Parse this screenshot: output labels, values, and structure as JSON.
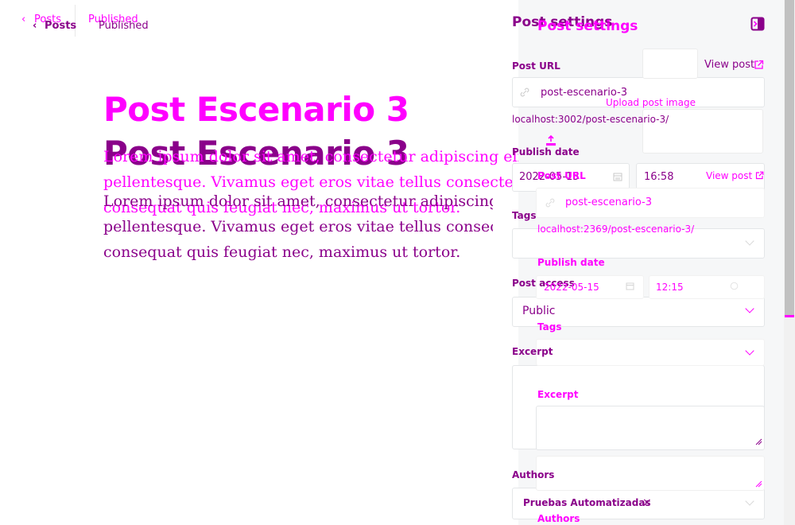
{
  "nav": {
    "back_label": "Posts",
    "status_label": "Published",
    "back_chevron": "‹",
    "back_icon": "chevron-left-icon"
  },
  "editor": {
    "title": "Post Escenario 3",
    "body_lines": [
      "Lorem ipsum dolor sit amet, consectetur adipiscing elit. Ut gravida",
      "pellentesque. Vivamus eget eros vitae tellus consectetur porttitor",
      "consequat quis feugiat nec, maximus ut tortor."
    ]
  },
  "settings_panel": {
    "title": "Post settings",
    "close_icon": "panel-close-icon",
    "upload_image_label": "Upload post image",
    "post_url_label": "Post URL",
    "view_post_label": "View post",
    "slug": "post-escenario-3",
    "url_preview_a": "localhost:3002/post-escenario-3/",
    "url_preview_b": "localhost:2369/post-escenario-3/",
    "publish_date_label": "Publish date",
    "publish_date_a": "2022-05-15",
    "publish_time_a": "16:58",
    "publish_date_b": "2022-05-15",
    "publish_time_b": "12:15",
    "tags_label": "Tags",
    "post_access_label": "Post access",
    "post_access_value": "Public",
    "excerpt_label": "Excerpt",
    "authors_label": "Authors",
    "author_chip": "Pruebas Automatizadas",
    "chip_remove": "×"
  },
  "colors": {
    "accent_magenta": "#ff00ff",
    "accent_purple": "#8a008a",
    "panel_bg": "#f6f7f8"
  }
}
